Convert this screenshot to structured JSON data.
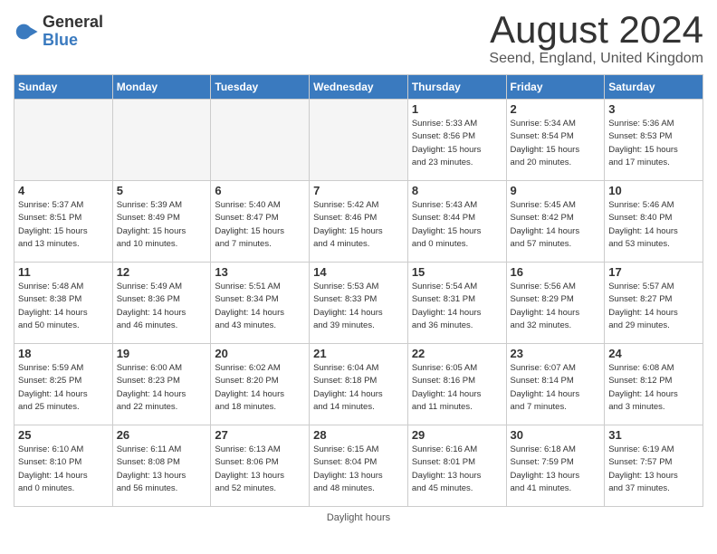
{
  "header": {
    "logo_general": "General",
    "logo_blue": "Blue",
    "month_title": "August 2024",
    "location": "Seend, England, United Kingdom"
  },
  "days_of_week": [
    "Sunday",
    "Monday",
    "Tuesday",
    "Wednesday",
    "Thursday",
    "Friday",
    "Saturday"
  ],
  "weeks": [
    [
      {
        "day": "",
        "info": ""
      },
      {
        "day": "",
        "info": ""
      },
      {
        "day": "",
        "info": ""
      },
      {
        "day": "",
        "info": ""
      },
      {
        "day": "1",
        "info": "Sunrise: 5:33 AM\nSunset: 8:56 PM\nDaylight: 15 hours\nand 23 minutes."
      },
      {
        "day": "2",
        "info": "Sunrise: 5:34 AM\nSunset: 8:54 PM\nDaylight: 15 hours\nand 20 minutes."
      },
      {
        "day": "3",
        "info": "Sunrise: 5:36 AM\nSunset: 8:53 PM\nDaylight: 15 hours\nand 17 minutes."
      }
    ],
    [
      {
        "day": "4",
        "info": "Sunrise: 5:37 AM\nSunset: 8:51 PM\nDaylight: 15 hours\nand 13 minutes."
      },
      {
        "day": "5",
        "info": "Sunrise: 5:39 AM\nSunset: 8:49 PM\nDaylight: 15 hours\nand 10 minutes."
      },
      {
        "day": "6",
        "info": "Sunrise: 5:40 AM\nSunset: 8:47 PM\nDaylight: 15 hours\nand 7 minutes."
      },
      {
        "day": "7",
        "info": "Sunrise: 5:42 AM\nSunset: 8:46 PM\nDaylight: 15 hours\nand 4 minutes."
      },
      {
        "day": "8",
        "info": "Sunrise: 5:43 AM\nSunset: 8:44 PM\nDaylight: 15 hours\nand 0 minutes."
      },
      {
        "day": "9",
        "info": "Sunrise: 5:45 AM\nSunset: 8:42 PM\nDaylight: 14 hours\nand 57 minutes."
      },
      {
        "day": "10",
        "info": "Sunrise: 5:46 AM\nSunset: 8:40 PM\nDaylight: 14 hours\nand 53 minutes."
      }
    ],
    [
      {
        "day": "11",
        "info": "Sunrise: 5:48 AM\nSunset: 8:38 PM\nDaylight: 14 hours\nand 50 minutes."
      },
      {
        "day": "12",
        "info": "Sunrise: 5:49 AM\nSunset: 8:36 PM\nDaylight: 14 hours\nand 46 minutes."
      },
      {
        "day": "13",
        "info": "Sunrise: 5:51 AM\nSunset: 8:34 PM\nDaylight: 14 hours\nand 43 minutes."
      },
      {
        "day": "14",
        "info": "Sunrise: 5:53 AM\nSunset: 8:33 PM\nDaylight: 14 hours\nand 39 minutes."
      },
      {
        "day": "15",
        "info": "Sunrise: 5:54 AM\nSunset: 8:31 PM\nDaylight: 14 hours\nand 36 minutes."
      },
      {
        "day": "16",
        "info": "Sunrise: 5:56 AM\nSunset: 8:29 PM\nDaylight: 14 hours\nand 32 minutes."
      },
      {
        "day": "17",
        "info": "Sunrise: 5:57 AM\nSunset: 8:27 PM\nDaylight: 14 hours\nand 29 minutes."
      }
    ],
    [
      {
        "day": "18",
        "info": "Sunrise: 5:59 AM\nSunset: 8:25 PM\nDaylight: 14 hours\nand 25 minutes."
      },
      {
        "day": "19",
        "info": "Sunrise: 6:00 AM\nSunset: 8:23 PM\nDaylight: 14 hours\nand 22 minutes."
      },
      {
        "day": "20",
        "info": "Sunrise: 6:02 AM\nSunset: 8:20 PM\nDaylight: 14 hours\nand 18 minutes."
      },
      {
        "day": "21",
        "info": "Sunrise: 6:04 AM\nSunset: 8:18 PM\nDaylight: 14 hours\nand 14 minutes."
      },
      {
        "day": "22",
        "info": "Sunrise: 6:05 AM\nSunset: 8:16 PM\nDaylight: 14 hours\nand 11 minutes."
      },
      {
        "day": "23",
        "info": "Sunrise: 6:07 AM\nSunset: 8:14 PM\nDaylight: 14 hours\nand 7 minutes."
      },
      {
        "day": "24",
        "info": "Sunrise: 6:08 AM\nSunset: 8:12 PM\nDaylight: 14 hours\nand 3 minutes."
      }
    ],
    [
      {
        "day": "25",
        "info": "Sunrise: 6:10 AM\nSunset: 8:10 PM\nDaylight: 14 hours\nand 0 minutes."
      },
      {
        "day": "26",
        "info": "Sunrise: 6:11 AM\nSunset: 8:08 PM\nDaylight: 13 hours\nand 56 minutes."
      },
      {
        "day": "27",
        "info": "Sunrise: 6:13 AM\nSunset: 8:06 PM\nDaylight: 13 hours\nand 52 minutes."
      },
      {
        "day": "28",
        "info": "Sunrise: 6:15 AM\nSunset: 8:04 PM\nDaylight: 13 hours\nand 48 minutes."
      },
      {
        "day": "29",
        "info": "Sunrise: 6:16 AM\nSunset: 8:01 PM\nDaylight: 13 hours\nand 45 minutes."
      },
      {
        "day": "30",
        "info": "Sunrise: 6:18 AM\nSunset: 7:59 PM\nDaylight: 13 hours\nand 41 minutes."
      },
      {
        "day": "31",
        "info": "Sunrise: 6:19 AM\nSunset: 7:57 PM\nDaylight: 13 hours\nand 37 minutes."
      }
    ]
  ],
  "footer": {
    "note": "Daylight hours"
  }
}
